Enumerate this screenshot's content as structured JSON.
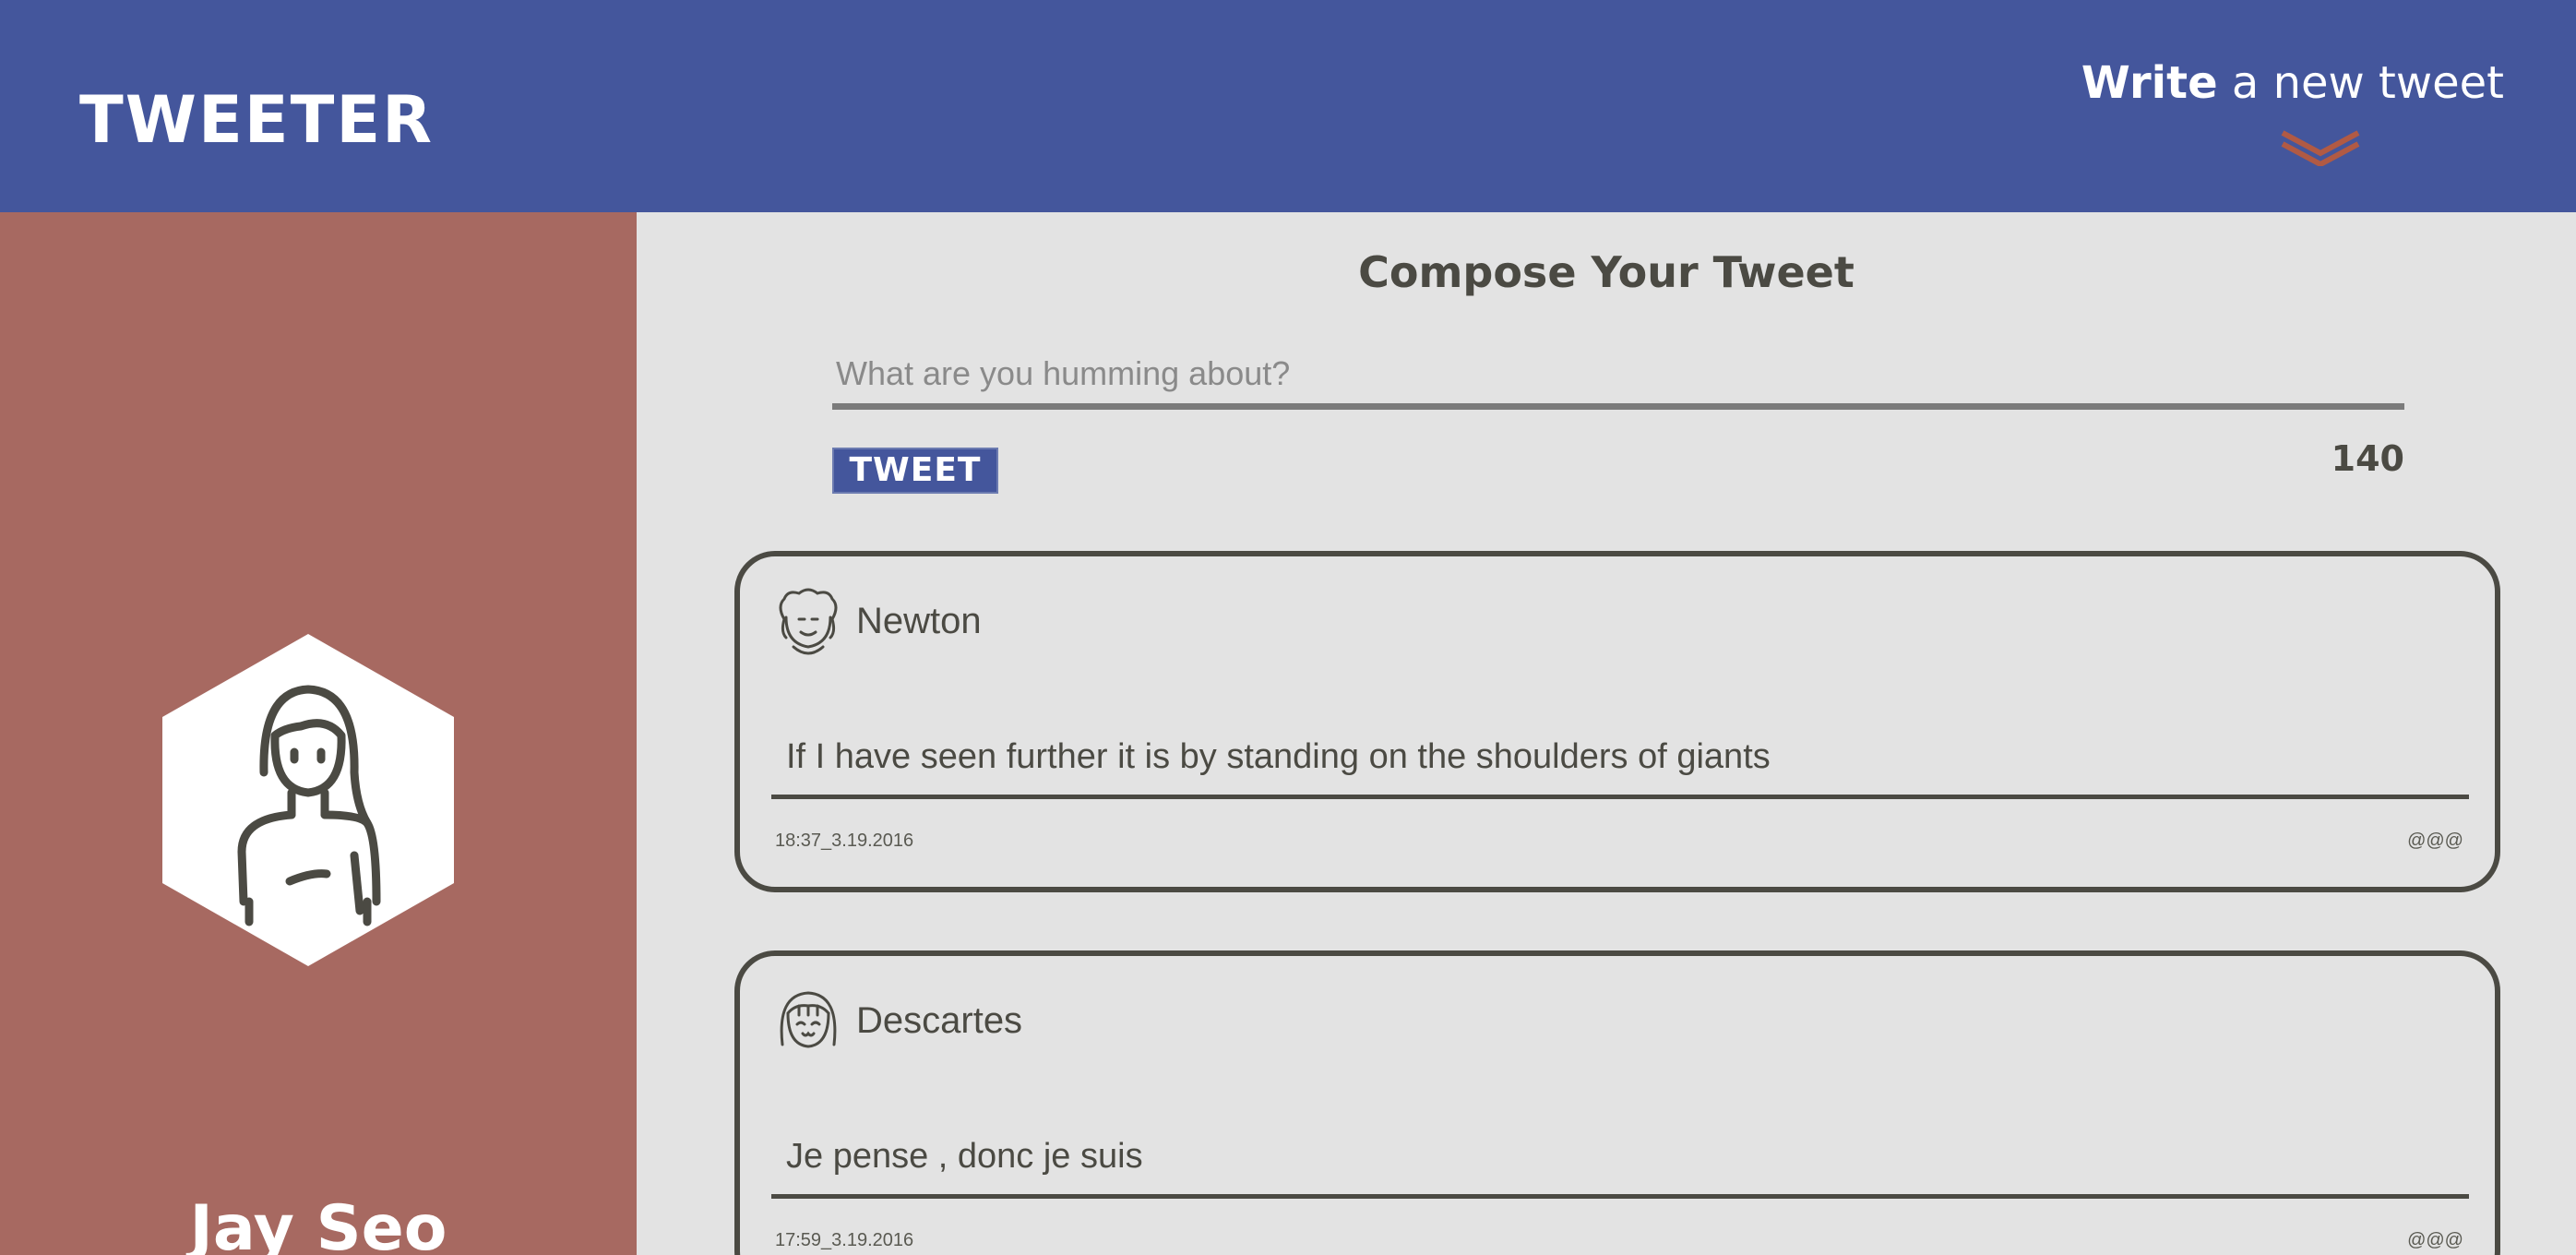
{
  "header": {
    "brand": "TWEETER",
    "compose_toggle_strong": "Write",
    "compose_toggle_rest": " a new tweet"
  },
  "sidebar": {
    "user_name": "Jay Seo"
  },
  "compose": {
    "title": "Compose Your Tweet",
    "placeholder": "What are you humming about?",
    "button_label": "TWEET",
    "char_counter": "140"
  },
  "tweets": [
    {
      "author": "Newton",
      "text": "If I have seen further it is by standing on the shoulders of giants",
      "timestamp": "18:37_3.19.2016",
      "actions": "@@@"
    },
    {
      "author": "Descartes",
      "text": "Je pense , donc je suis",
      "timestamp": "17:59_3.19.2016",
      "actions": "@@@"
    }
  ],
  "colors": {
    "header_bg": "#44569c",
    "sidebar_bg": "#a76961",
    "page_bg": "#e3e3e3",
    "text_dark": "#4b4a43",
    "chevron": "#b15a44"
  },
  "icons": {
    "chevron": "chevron-down-icon",
    "profile_avatar": "user-avatar-icon",
    "newton_avatar": "newton-avatar-icon",
    "descartes_avatar": "descartes-avatar-icon"
  }
}
